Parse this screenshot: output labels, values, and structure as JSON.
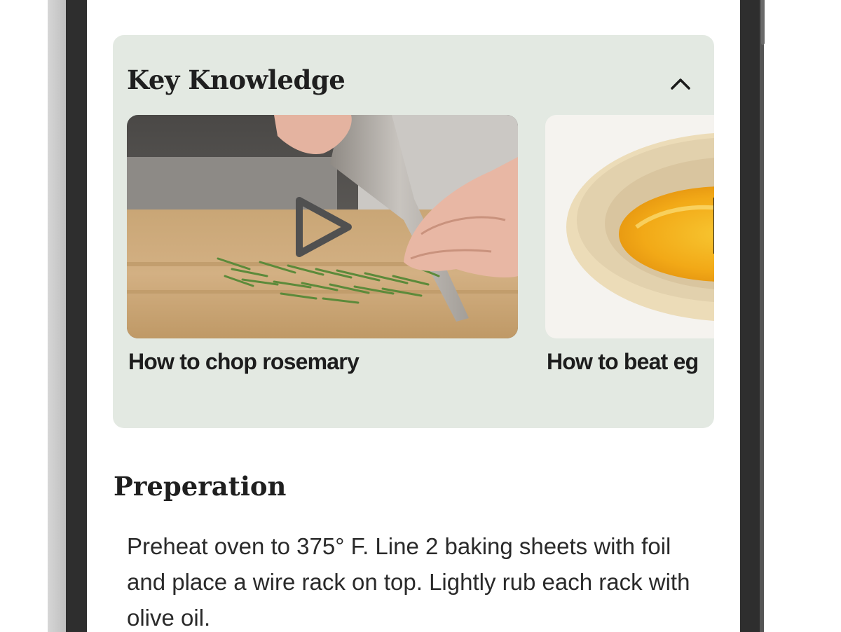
{
  "key_knowledge": {
    "title": "Key Knowledge",
    "toggle_icon": "chevron-up-icon",
    "videos": [
      {
        "label": "How to chop rosemary",
        "icon": "play-icon"
      },
      {
        "label": "How to beat eg"
      }
    ]
  },
  "preparation": {
    "title": "Preperation",
    "step_text": "Preheat oven to 375° F. Line 2 baking sheets with foil and place a wire rack on top. Lightly rub each rack with olive oil."
  },
  "colors": {
    "card_background": "#e3e9e2",
    "text": "#1f1f1f",
    "frame": "#2e2e2e"
  }
}
